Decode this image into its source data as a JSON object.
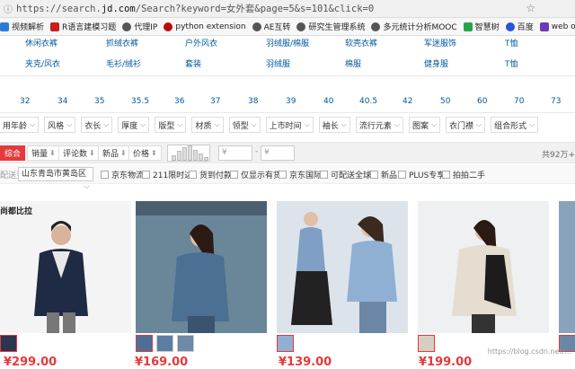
{
  "browser": {
    "url_prefix": "https://search.",
    "url_domain": "jd.com",
    "url_rest": "/Search?keyword=女外套&page=5&s=101&click=0",
    "bookmarks": [
      "视频解析",
      "R语言建模习题",
      "代理IP",
      "python extension",
      "AE互转",
      "研究生管理系统",
      "多元统计分析MOOC",
      "智慧树",
      "百度",
      "web of science"
    ]
  },
  "categories": {
    "row1": [
      "休闲衣裤",
      "抓绒衣裤",
      "户外风衣",
      "羽绒服/棉服",
      "软壳衣裤",
      "军迷服饰",
      "T恤"
    ],
    "row2": [
      "夹克/风衣",
      "毛衫/绒衫",
      "套装",
      "羽绒服",
      "棉服",
      "健身服",
      "T恤"
    ]
  },
  "sizes": [
    "32",
    "34",
    "35",
    "35.5",
    "36",
    "37",
    "38",
    "39",
    "40",
    "40.5",
    "42",
    "50",
    "60",
    "70",
    "73"
  ],
  "attributes": [
    "用年龄",
    "风格",
    "衣长",
    "厚度",
    "版型",
    "材质",
    "领型",
    "上市时间",
    "袖长",
    "流行元素",
    "图案",
    "衣门襟",
    "组合形式"
  ],
  "sort": {
    "buttons": [
      "综合",
      "销量",
      "评论数",
      "新品",
      "价格"
    ],
    "arrows": [
      "⬇",
      "⬇",
      "⬇",
      "⬇",
      "⬍"
    ],
    "price_placeholder": "¥",
    "dash": "-",
    "page_info": "共92万+"
  },
  "filters": {
    "ship_label": "配送至",
    "location": "山东青岛市黄岛区",
    "options": [
      "京东物流",
      "211限时达",
      "货到付款",
      "仅显示有货",
      "京东国际",
      "可配送全球",
      "新品",
      "PLUS专享",
      "拍拍二手"
    ]
  },
  "products": [
    {
      "price": "¥299.00",
      "brand": "尚都比拉"
    },
    {
      "price": "¥169.00",
      "brand": ""
    },
    {
      "price": "¥139.00",
      "brand": ""
    },
    {
      "price": "¥199.00",
      "brand": ""
    }
  ],
  "watermark": "https://blog.csdn.net/..."
}
